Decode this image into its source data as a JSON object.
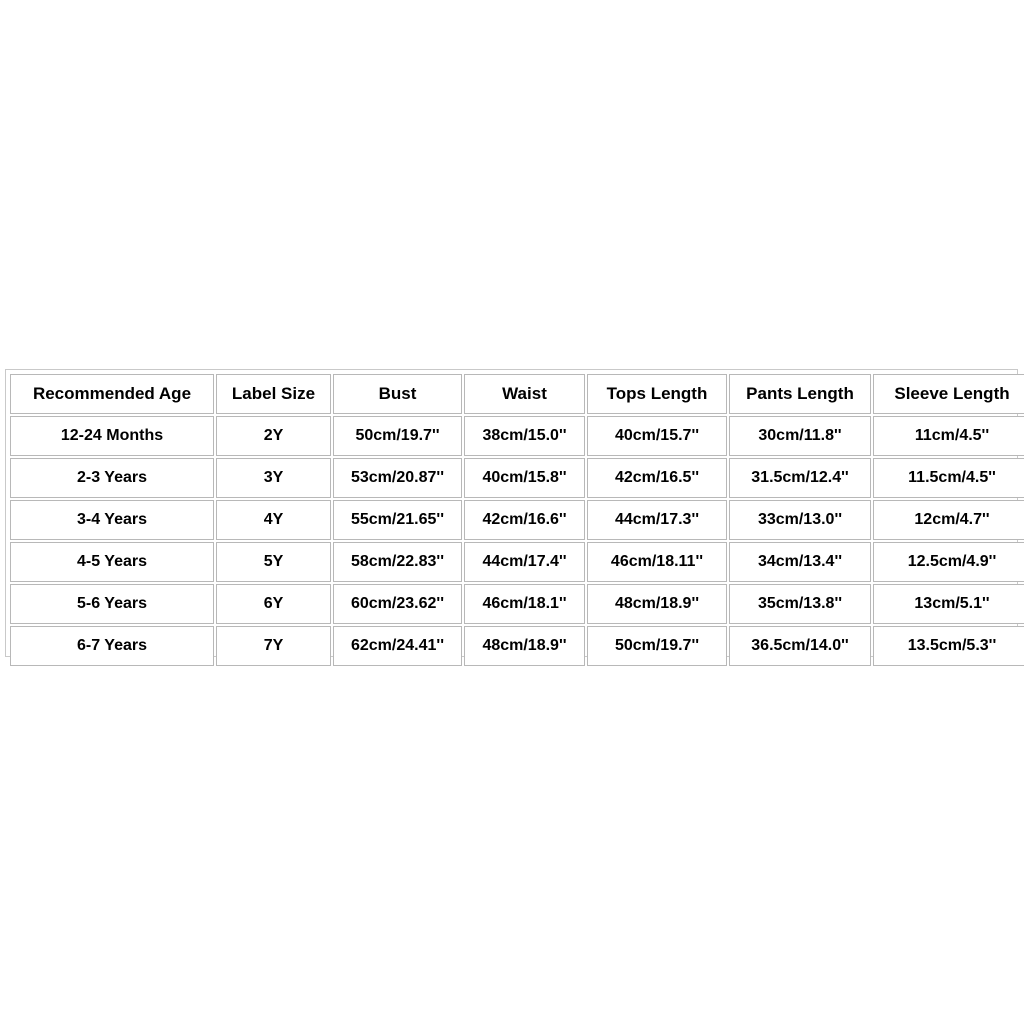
{
  "colors": {
    "page_background": "#ffffff",
    "cell_background": "#ffffff",
    "text": "#000000",
    "cell_border": "#b8b8b8",
    "outer_border": "#c9c9c9"
  },
  "chart_data": {
    "type": "table",
    "title": "",
    "columns": [
      "Recommended Age",
      "Label Size",
      "Bust",
      "Waist",
      "Tops Length",
      "Pants Length",
      "Sleeve Length"
    ],
    "rows": [
      [
        "12-24 Months",
        "2Y",
        "50cm/19.7''",
        "38cm/15.0''",
        "40cm/15.7''",
        "30cm/11.8''",
        "11cm/4.5''"
      ],
      [
        "2-3 Years",
        "3Y",
        "53cm/20.87''",
        "40cm/15.8''",
        "42cm/16.5''",
        "31.5cm/12.4''",
        "11.5cm/4.5''"
      ],
      [
        "3-4 Years",
        "4Y",
        "55cm/21.65''",
        "42cm/16.6''",
        "44cm/17.3''",
        "33cm/13.0''",
        "12cm/4.7''"
      ],
      [
        "4-5 Years",
        "5Y",
        "58cm/22.83''",
        "44cm/17.4''",
        "46cm/18.11''",
        "34cm/13.4''",
        "12.5cm/4.9''"
      ],
      [
        "5-6 Years",
        "6Y",
        "60cm/23.62''",
        "46cm/18.1''",
        "48cm/18.9''",
        "35cm/13.8''",
        "13cm/5.1''"
      ],
      [
        "6-7 Years",
        "7Y",
        "62cm/24.41''",
        "48cm/18.9''",
        "50cm/19.7''",
        "36.5cm/14.0''",
        "13.5cm/5.3''"
      ]
    ]
  },
  "size_chart": {
    "headers": [
      {
        "label": "Recommended Age"
      },
      {
        "label": "Label Size"
      },
      {
        "label": "Bust"
      },
      {
        "label": "Waist"
      },
      {
        "label": "Tops Length"
      },
      {
        "label": "Pants Length"
      },
      {
        "label": "Sleeve Length"
      }
    ],
    "rows": [
      {
        "recommended_age": "12-24 Months",
        "label_size": "2Y",
        "bust": "50cm/19.7''",
        "waist": "38cm/15.0''",
        "tops_length": "40cm/15.7''",
        "pants_length": "30cm/11.8''",
        "sleeve_length": "11cm/4.5''"
      },
      {
        "recommended_age": "2-3 Years",
        "label_size": "3Y",
        "bust": "53cm/20.87''",
        "waist": "40cm/15.8''",
        "tops_length": "42cm/16.5''",
        "pants_length": "31.5cm/12.4''",
        "sleeve_length": "11.5cm/4.5''"
      },
      {
        "recommended_age": "3-4 Years",
        "label_size": "4Y",
        "bust": "55cm/21.65''",
        "waist": "42cm/16.6''",
        "tops_length": "44cm/17.3''",
        "pants_length": "33cm/13.0''",
        "sleeve_length": "12cm/4.7''"
      },
      {
        "recommended_age": "4-5 Years",
        "label_size": "5Y",
        "bust": "58cm/22.83''",
        "waist": "44cm/17.4''",
        "tops_length": "46cm/18.11''",
        "pants_length": "34cm/13.4''",
        "sleeve_length": "12.5cm/4.9''"
      },
      {
        "recommended_age": "5-6 Years",
        "label_size": "6Y",
        "bust": "60cm/23.62''",
        "waist": "46cm/18.1''",
        "tops_length": "48cm/18.9''",
        "pants_length": "35cm/13.8''",
        "sleeve_length": "13cm/5.1''"
      },
      {
        "recommended_age": "6-7 Years",
        "label_size": "7Y",
        "bust": "62cm/24.41''",
        "waist": "48cm/18.9''",
        "tops_length": "50cm/19.7''",
        "pants_length": "36.5cm/14.0''",
        "sleeve_length": "13.5cm/5.3''"
      }
    ]
  }
}
